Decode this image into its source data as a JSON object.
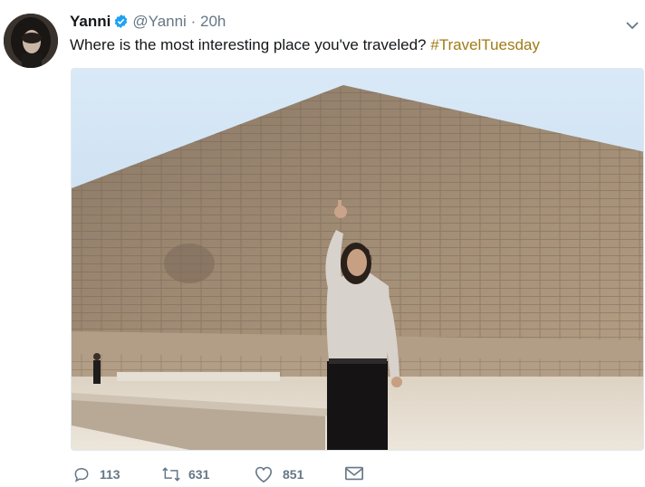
{
  "tweet": {
    "author_name": "Yanni",
    "handle": "@Yanni",
    "separator": "·",
    "time": "20h",
    "text": "Where is the most interesting place you've traveled?",
    "hashtag": "#TravelTuesday",
    "verified_icon": "verified-badge-icon",
    "menu_icon": "chevron-down-icon"
  },
  "media": {
    "icon": "photo"
  },
  "actions": {
    "reply": {
      "icon": "reply-icon",
      "count": "113"
    },
    "retweet": {
      "icon": "retweet-icon",
      "count": "631"
    },
    "like": {
      "icon": "heart-icon",
      "count": "851"
    },
    "dm": {
      "icon": "envelope-icon"
    }
  },
  "colors": {
    "hashtag": "#a07a16",
    "verified": "#1da1f2",
    "muted": "#657786"
  }
}
